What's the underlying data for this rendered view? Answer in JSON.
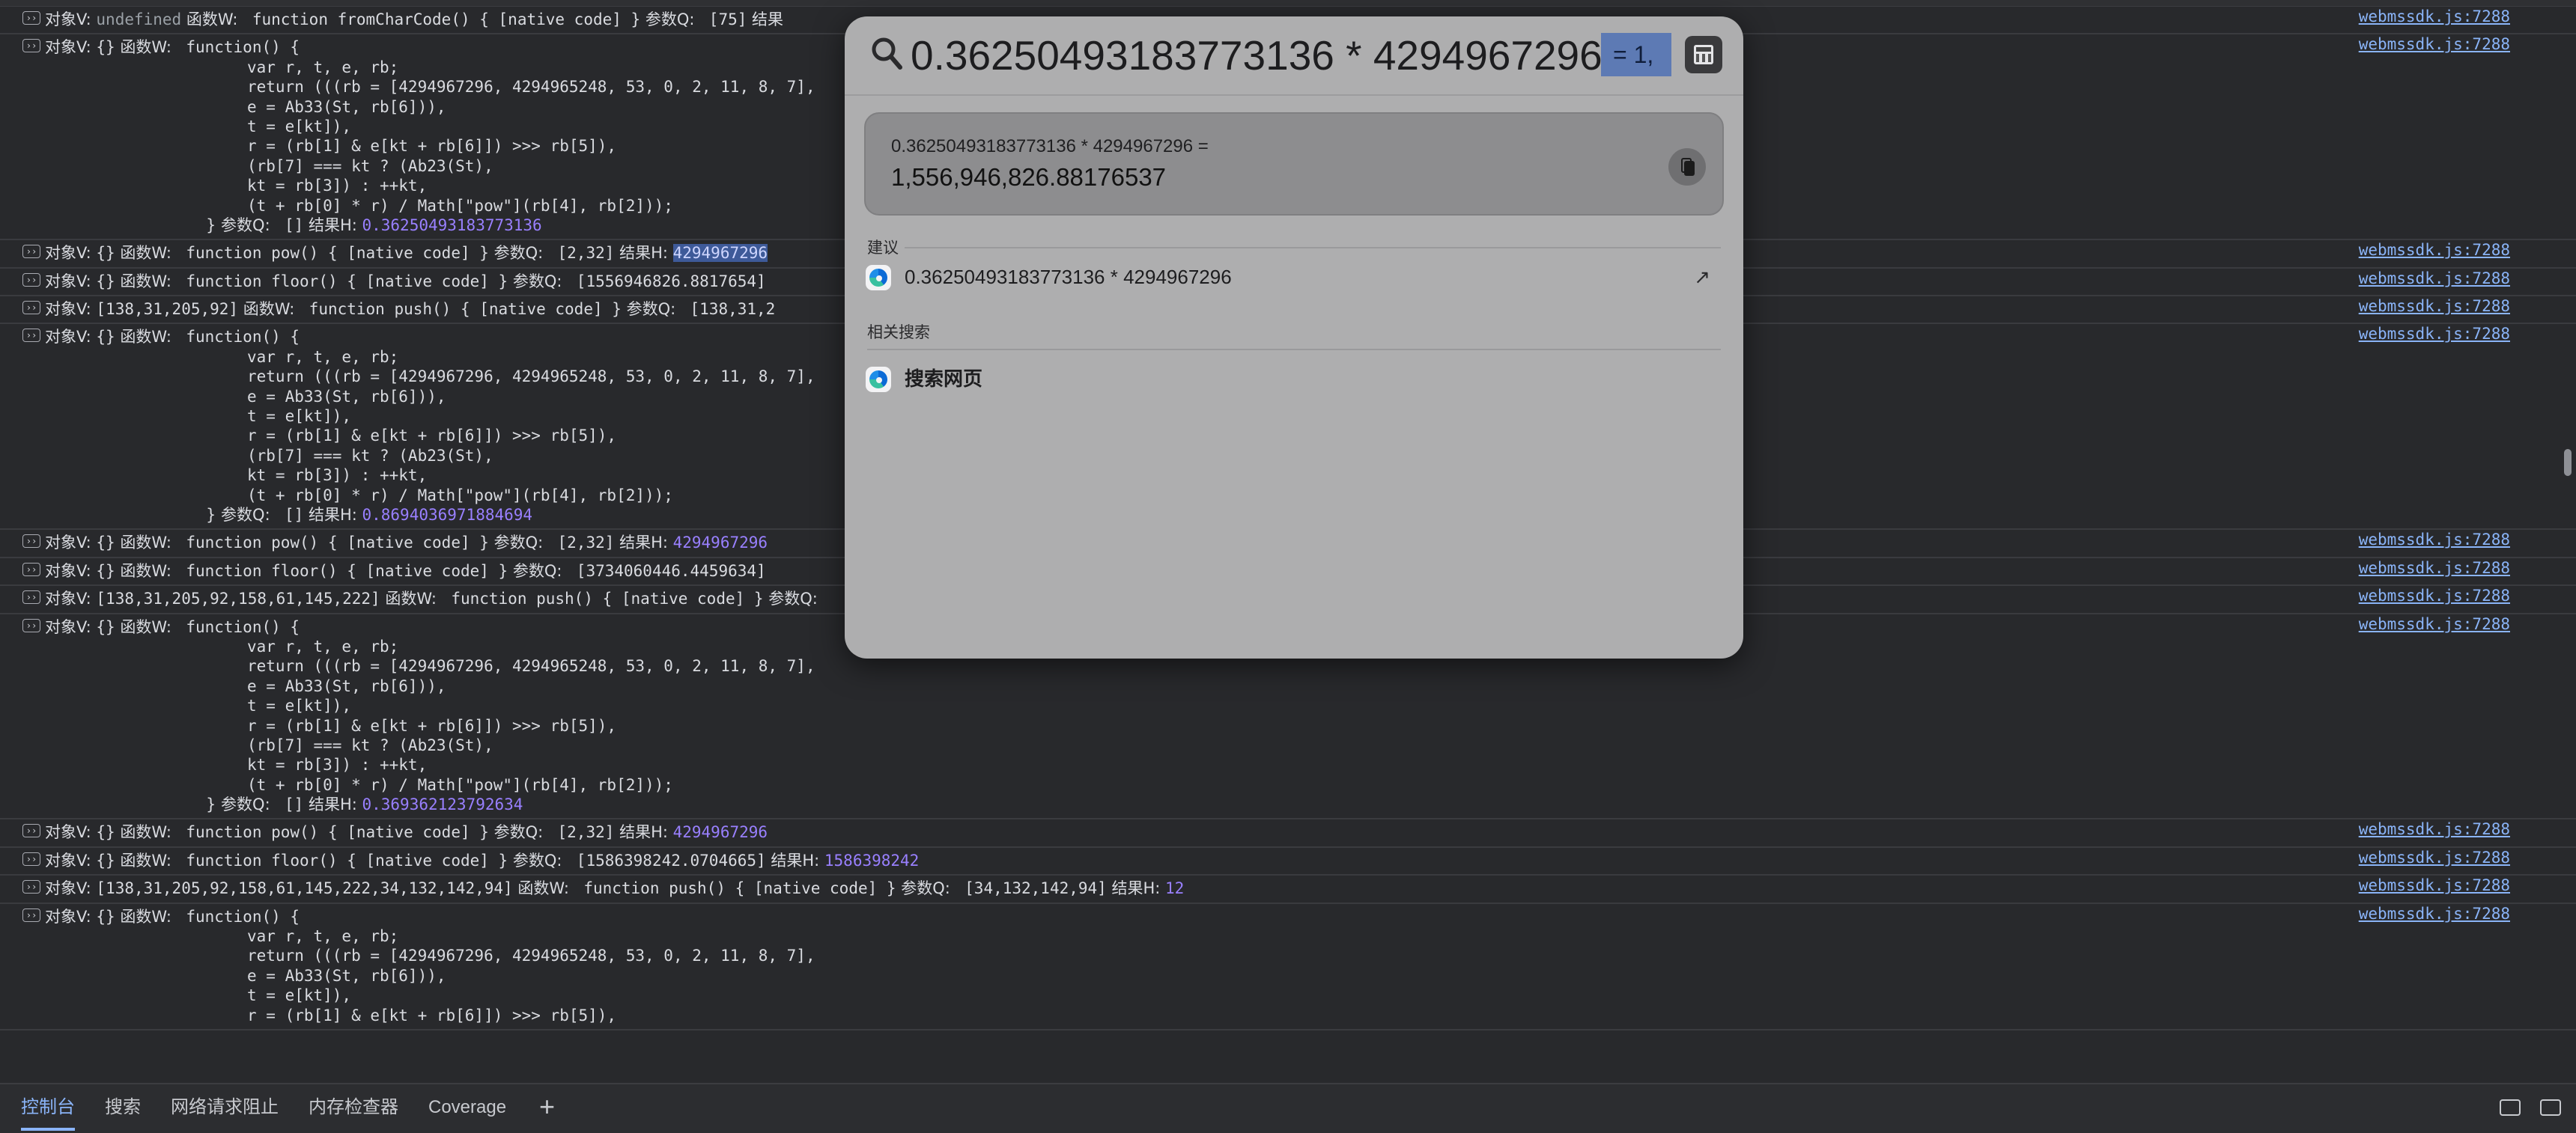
{
  "console": {
    "source_link": "webmssdk.js:7288",
    "function_body": [
      "var r, t, e, rb;",
      "return (((rb = [4294967296, 4294965248, 53, 0, 2, 11, 8, 7],",
      "e = Ab33(St, rb[6])),",
      "t = e[kt]),",
      "r = (rb[1] & e[kt + rb[6]]) >>> rb[5]),",
      "(rb[7] === kt ? (Ab23(St),",
      "kt = rb[3]) : ++kt,",
      "(t + rb[0] * r) / Math[\"pow\"](rb[4], rb[2]));"
    ],
    "labels": {
      "obj": "对象V: ",
      "fn": " 函数W: ",
      "param": " 参数Q: ",
      "result": " 结果H: ",
      "close_param": "} 参数Q: ",
      "fn_open": " function() {"
    },
    "entries": [
      {
        "kind": "simple",
        "obj": "undefined",
        "fn": " function fromCharCode() { [native code] }",
        "param": " [75]",
        "result_label": " 结果",
        "result": ""
      },
      {
        "kind": "block",
        "obj": "{}",
        "param": " []",
        "result": "0.36250493183773136"
      },
      {
        "kind": "simple",
        "obj": "{}",
        "fn": " function pow() { [native code] }",
        "param": " [2,32]",
        "result_label": " 结果H: ",
        "result": "4294967296",
        "selected": true
      },
      {
        "kind": "simple",
        "obj": "{}",
        "fn": " function floor() { [native code] }",
        "param": " [1556946826.8817654]",
        "result_label": "",
        "result": ""
      },
      {
        "kind": "simple",
        "obj": "[138,31,205,92]",
        "fn": " function push() { [native code] }",
        "param": " [138,31,2",
        "result_label": "",
        "result": ""
      },
      {
        "kind": "block",
        "obj": "{}",
        "param": " []",
        "result": "0.8694036971884694"
      },
      {
        "kind": "simple",
        "obj": "{}",
        "fn": " function pow() { [native code] }",
        "param": " [2,32]",
        "result_label": " 结果H: ",
        "result": "4294967296"
      },
      {
        "kind": "simple",
        "obj": "{}",
        "fn": " function floor() { [native code] }",
        "param": " [3734060446.4459634]",
        "result_label": "",
        "result": ""
      },
      {
        "kind": "simple",
        "obj": "[138,31,205,92,158,61,145,222]",
        "fn": " function push() { [native code] }",
        "param": "",
        "result_label": "",
        "result": ""
      },
      {
        "kind": "block",
        "obj": "{}",
        "param": " []",
        "result": "0.369362123792634"
      },
      {
        "kind": "simple",
        "obj": "{}",
        "fn": " function pow() { [native code] }",
        "param": " [2,32]",
        "result_label": " 结果H: ",
        "result": "4294967296"
      },
      {
        "kind": "simple",
        "obj": "{}",
        "fn": " function floor() { [native code] }",
        "param": " [1586398242.0704665]",
        "result_label": " 结果H: ",
        "result": "1586398242"
      },
      {
        "kind": "simple",
        "obj": "[138,31,205,92,158,61,145,222,34,132,142,94]",
        "fn": " function push() { [native code] }",
        "param": " [34,132,142,94]",
        "result_label": " 结果H: ",
        "result": "12"
      },
      {
        "kind": "block_partial",
        "obj": "{}",
        "lines": 5
      }
    ]
  },
  "drawer": {
    "tabs": [
      "控制台",
      "搜索",
      "网络请求阻止",
      "内存检查器",
      "Coverage"
    ],
    "active_tab": 0,
    "add_label": "+",
    "accent": "#8ab4f8"
  },
  "spotlight": {
    "query": "0.36250493183773136 * 4294967296",
    "inline_result": "= 1,",
    "result_expression": "0.36250493183773136 * 4294967296 =",
    "result_value": "1,556,946,826.88176537",
    "suggestions_title": "建议",
    "suggestion": "0.36250493183773136 * 4294967296",
    "related_title": "相关搜索",
    "related": "搜索网页"
  }
}
